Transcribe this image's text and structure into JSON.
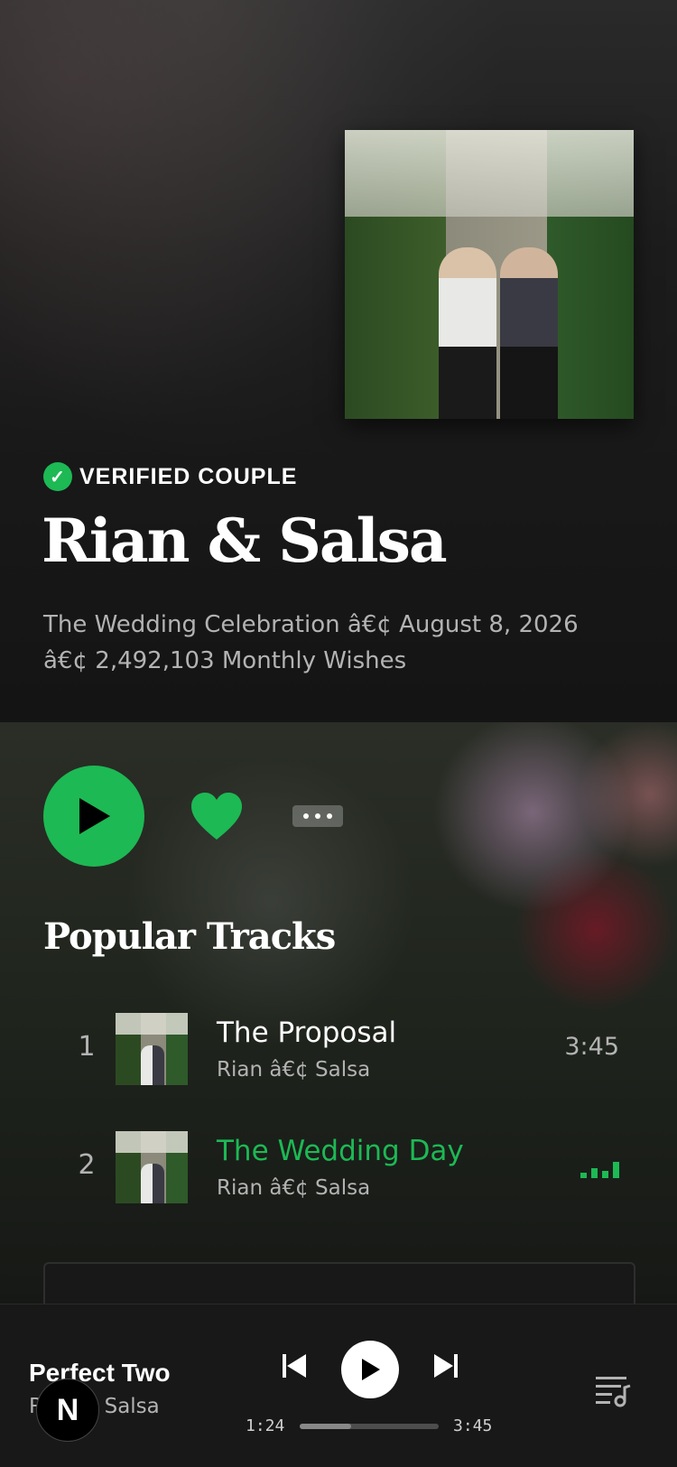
{
  "hero": {
    "badge": "VERIFIED COUPLE",
    "title": "Rian & Salsa",
    "meta_line1": "The Wedding Celebration â€¢ August 8, 2026",
    "meta_line2": "â€¢ 2,492,103 Monthly Wishes"
  },
  "actions": {
    "play_icon": "play-icon",
    "like_icon": "heart-icon",
    "more_icon": "ellipsis-icon"
  },
  "popular": {
    "title": "Popular Tracks",
    "tracks": [
      {
        "num": "1",
        "name": "The Proposal",
        "artist": "Rian â€¢ Salsa",
        "duration": "3:45",
        "playing": false
      },
      {
        "num": "2",
        "name": "The Wedding Day",
        "artist": "Rian â€¢ Salsa",
        "duration": "",
        "playing": true
      }
    ]
  },
  "player": {
    "title": "Perfect Two",
    "artist": "Rian & Salsa",
    "logo_letter": "N",
    "current_time": "1:24",
    "total_time": "3:45",
    "progress": 0.37
  },
  "colors": {
    "accent": "#1db954",
    "background": "#121212",
    "muted_text": "#b3b3b3"
  }
}
